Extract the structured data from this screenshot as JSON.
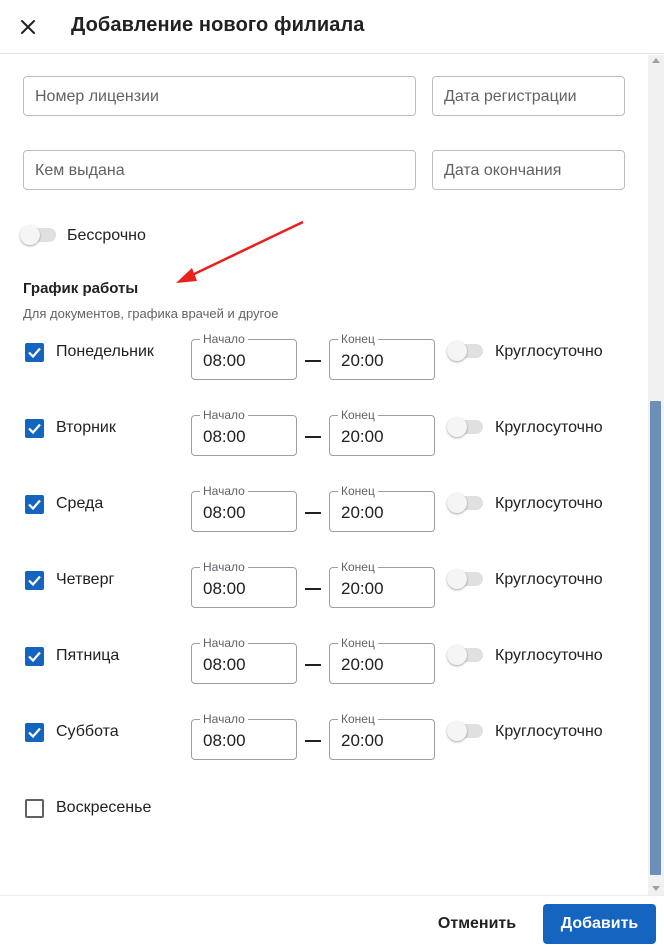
{
  "header": {
    "title": "Добавление нового филиала",
    "close_icon": "close-icon"
  },
  "license": {
    "number_placeholder": "Номер лицензии",
    "reg_date_placeholder": "Дата регистрации",
    "issued_by_placeholder": "Кем выдана",
    "end_date_placeholder": "Дата окончания",
    "unlimited_label": "Бессрочно",
    "unlimited_enabled": false
  },
  "schedule": {
    "title": "График работы",
    "subtitle": "Для документов, графика врачей и другое",
    "start_legend": "Начало",
    "end_legend": "Конец",
    "around_clock_label": "Круглосуточно",
    "days": [
      {
        "name": "Понедельник",
        "checked": true,
        "start": "08:00",
        "end": "20:00",
        "around_clock": false
      },
      {
        "name": "Вторник",
        "checked": true,
        "start": "08:00",
        "end": "20:00",
        "around_clock": false
      },
      {
        "name": "Среда",
        "checked": true,
        "start": "08:00",
        "end": "20:00",
        "around_clock": false
      },
      {
        "name": "Четверг",
        "checked": true,
        "start": "08:00",
        "end": "20:00",
        "around_clock": false
      },
      {
        "name": "Пятница",
        "checked": true,
        "start": "08:00",
        "end": "20:00",
        "around_clock": false
      },
      {
        "name": "Суббота",
        "checked": true,
        "start": "08:00",
        "end": "20:00",
        "around_clock": false
      },
      {
        "name": "Воскресенье",
        "checked": false
      }
    ]
  },
  "footer": {
    "cancel_label": "Отменить",
    "add_label": "Добавить"
  },
  "colors": {
    "primary": "#1565c0",
    "annotation_arrow": "#e8211b"
  }
}
